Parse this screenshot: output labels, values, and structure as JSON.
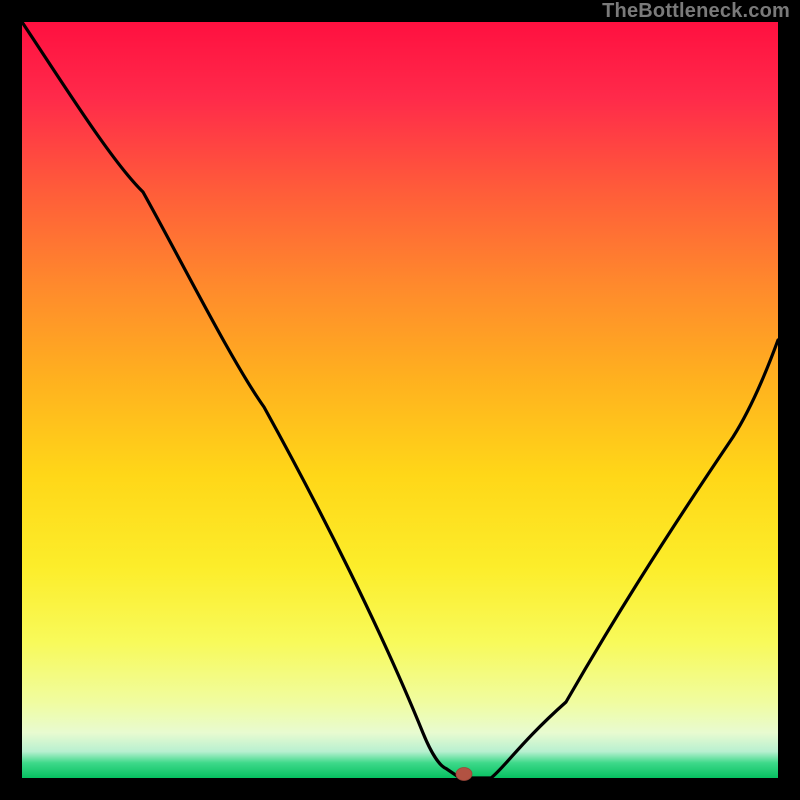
{
  "watermark": "TheBottleneck.com",
  "chart_data": {
    "type": "line",
    "title": "",
    "xlabel": "",
    "ylabel": "",
    "xlim": [
      0,
      100
    ],
    "ylim": [
      0,
      100
    ],
    "grid": false,
    "legend": false,
    "series": [
      {
        "name": "bottleneck-curve",
        "x": [
          0,
          8,
          16,
          24,
          32,
          40,
          48,
          53,
          56,
          58,
          62,
          66,
          72,
          78,
          86,
          94,
          100
        ],
        "y": [
          100,
          89,
          78,
          66,
          49,
          33,
          17,
          6,
          1.2,
          0,
          0,
          2,
          10,
          22,
          38,
          52,
          62
        ]
      }
    ],
    "marker": {
      "name": "optimal-point",
      "x": 58.5,
      "y": 0.5,
      "color": "#b25242"
    },
    "gradient_stops": [
      {
        "pos": 0,
        "color": "#ff1040"
      },
      {
        "pos": 50,
        "color": "#ffc81a"
      },
      {
        "pos": 88,
        "color": "#f4fb86"
      },
      {
        "pos": 100,
        "color": "#06c060"
      }
    ]
  }
}
